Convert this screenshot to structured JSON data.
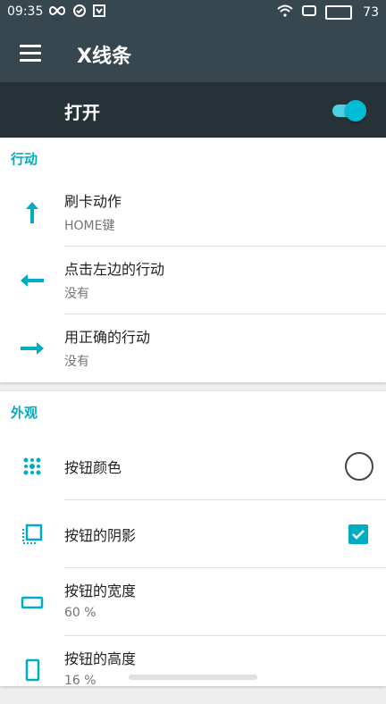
{
  "status_bar": {
    "time": "09:35",
    "battery": "73"
  },
  "app_bar": {
    "title": "X线条"
  },
  "master_switch": {
    "label": "打开",
    "enabled": true
  },
  "sections": [
    {
      "header": "行动",
      "items": [
        {
          "title": "刷卡动作",
          "value": "HOME键",
          "icon": "arrow-up-icon"
        },
        {
          "title": "点击左边的行动",
          "value": "没有",
          "icon": "arrow-left-icon"
        },
        {
          "title": "用正确的行动",
          "value": "没有",
          "icon": "arrow-right-icon"
        }
      ]
    },
    {
      "header": "外观",
      "items": [
        {
          "title": "按钮颜色",
          "icon": "color-dots-icon",
          "control": "color-circle"
        },
        {
          "title": "按钮的阴影",
          "icon": "shadow-icon",
          "control": "checkbox",
          "checked": true
        },
        {
          "title": "按钮的宽度",
          "value": "60 %",
          "icon": "width-icon"
        },
        {
          "title": "按钮的高度",
          "value": "16 %",
          "icon": "height-icon"
        }
      ]
    }
  ],
  "colors": {
    "accent": "#00acc1",
    "toolbar": "#37474f",
    "switch_bar": "#263238"
  }
}
